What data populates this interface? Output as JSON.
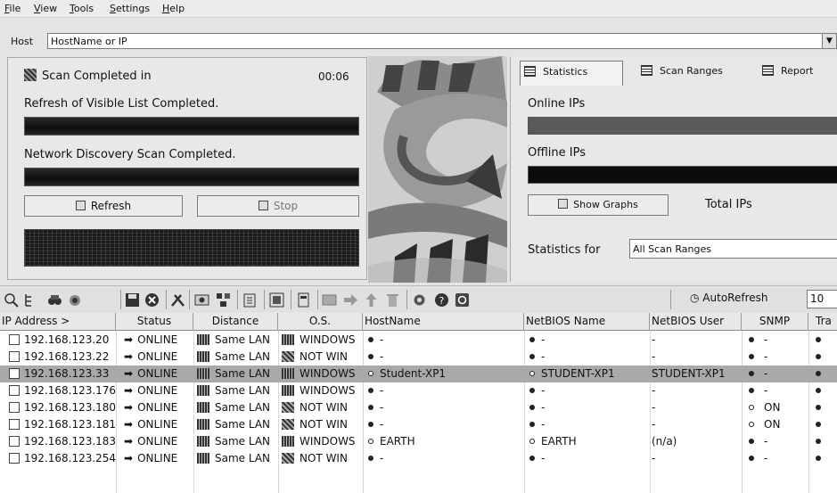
{
  "menu": [
    "File",
    "View",
    "Tools",
    "Settings",
    "Help"
  ],
  "host": {
    "label": "Host",
    "value": "HostName or IP",
    "dropdown_icon": "chevron-down-icon"
  },
  "scan": {
    "title": "Scan Completed in",
    "time": "00:06",
    "refresh_status": "Refresh of Visible List Completed.",
    "discovery_status": "Network Discovery Scan Completed.",
    "refresh_button": "Refresh",
    "stop_button": "Stop"
  },
  "right_panel": {
    "tabs": [
      "Statistics",
      "Scan Ranges",
      "Report"
    ],
    "online_label": "Online IPs",
    "offline_label": "Offline IPs",
    "show_graphs": "Show Graphs",
    "total_label": "Total IPs",
    "stats_for_label": "Statistics for",
    "stats_for_value": "All Scan Ranges"
  },
  "toolbar": {
    "autorefresh_label": "AutoRefresh",
    "autorefresh_value": "10"
  },
  "table": {
    "headers": [
      "IP Address >",
      "Status",
      "Distance",
      "O.S.",
      "HostName",
      "NetBIOS Name",
      "NetBIOS User",
      "SNMP",
      "Tra"
    ],
    "rows": [
      {
        "ip": "192.168.123.20",
        "status": "ONLINE",
        "distance": "Same LAN",
        "os": "WINDOWS",
        "host": "-",
        "netbios": "-",
        "user": "-",
        "snmp": "-",
        "selected": false,
        "hostring": false,
        "snmpring": false
      },
      {
        "ip": "192.168.123.22",
        "status": "ONLINE",
        "distance": "Same LAN",
        "os": "NOT WIN",
        "host": "-",
        "netbios": "-",
        "user": "-",
        "snmp": "-",
        "selected": false,
        "hostring": false,
        "snmpring": false
      },
      {
        "ip": "192.168.123.33",
        "status": "ONLINE",
        "distance": "Same LAN",
        "os": "WINDOWS",
        "host": "Student-XP1",
        "netbios": "STUDENT-XP1",
        "user": "STUDENT-XP1",
        "snmp": "-",
        "selected": true,
        "hostring": true,
        "snmpring": false
      },
      {
        "ip": "192.168.123.176",
        "status": "ONLINE",
        "distance": "Same LAN",
        "os": "WINDOWS",
        "host": "-",
        "netbios": "-",
        "user": "-",
        "snmp": "-",
        "selected": false,
        "hostring": false,
        "snmpring": false
      },
      {
        "ip": "192.168.123.180",
        "status": "ONLINE",
        "distance": "Same LAN",
        "os": "NOT WIN",
        "host": "-",
        "netbios": "-",
        "user": "-",
        "snmp": "ON",
        "selected": false,
        "hostring": false,
        "snmpring": true
      },
      {
        "ip": "192.168.123.181",
        "status": "ONLINE",
        "distance": "Same LAN",
        "os": "NOT WIN",
        "host": "-",
        "netbios": "-",
        "user": "-",
        "snmp": "ON",
        "selected": false,
        "hostring": false,
        "snmpring": true
      },
      {
        "ip": "192.168.123.183",
        "status": "ONLINE",
        "distance": "Same LAN",
        "os": "WINDOWS",
        "host": "EARTH",
        "netbios": "EARTH",
        "user": "(n/a)",
        "snmp": "-",
        "selected": false,
        "hostring": true,
        "snmpring": false
      },
      {
        "ip": "192.168.123.254",
        "status": "ONLINE",
        "distance": "Same LAN",
        "os": "NOT WIN",
        "host": "-",
        "netbios": "-",
        "user": "-",
        "snmp": "-",
        "selected": false,
        "hostring": false,
        "snmpring": false
      }
    ]
  }
}
